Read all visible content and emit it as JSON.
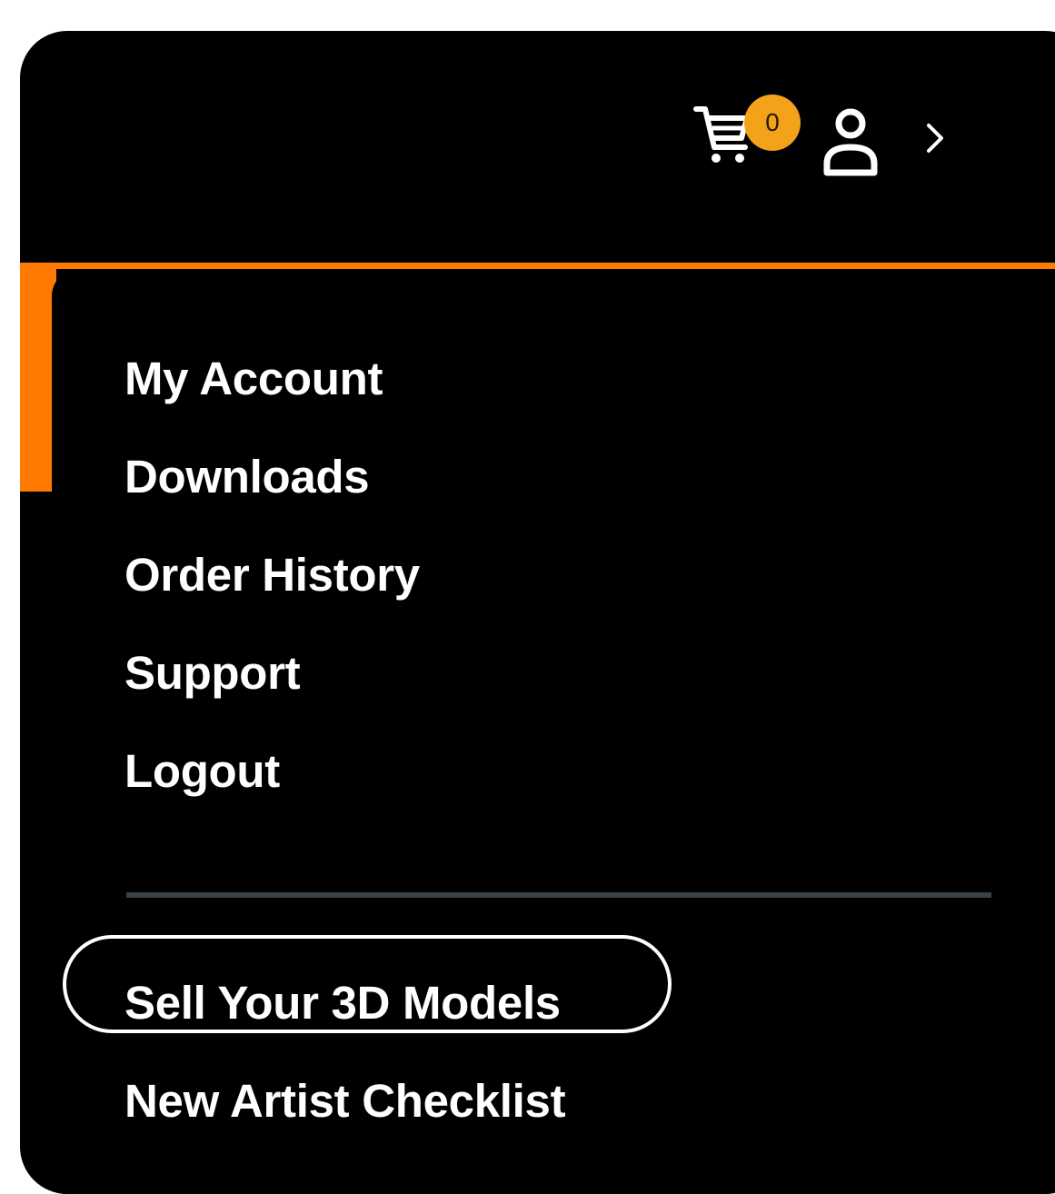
{
  "header": {
    "cart_count": "0",
    "cart_icon": "cart-icon",
    "user_icon": "user-icon",
    "chevron_icon": "chevron-right-icon"
  },
  "menu": {
    "items": [
      {
        "label": "My Account"
      },
      {
        "label": "Downloads"
      },
      {
        "label": "Order History"
      },
      {
        "label": "Support"
      },
      {
        "label": "Logout"
      }
    ],
    "secondary": [
      {
        "label": "Sell Your 3D Models"
      },
      {
        "label": "New Artist Checklist"
      }
    ]
  },
  "colors": {
    "background": "#000000",
    "accent": "#ff7a00",
    "badge": "#f3a21a",
    "divider": "#3a4248",
    "text": "#ffffff"
  }
}
